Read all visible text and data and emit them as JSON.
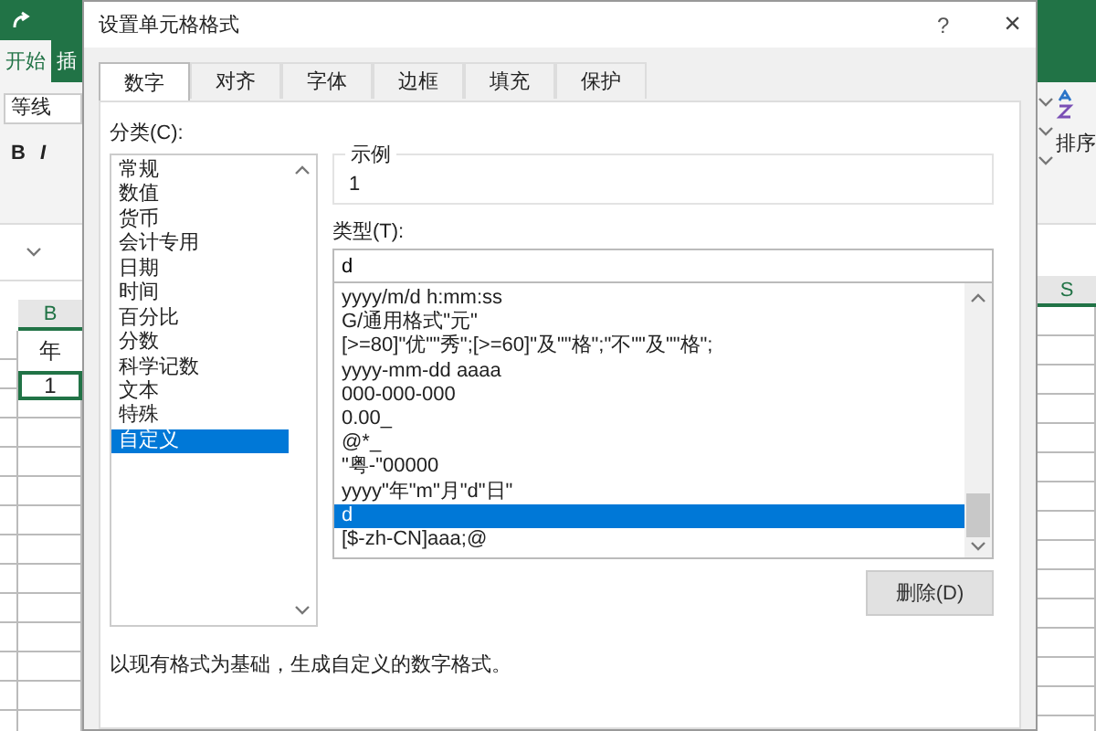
{
  "excel": {
    "ribbon_tabs": [
      {
        "label": "开始",
        "selected": true
      },
      {
        "label": "插",
        "selected": false
      }
    ],
    "font_name": "等线",
    "format_buttons": [
      "B",
      "I"
    ],
    "column_headers": [
      "B",
      "S"
    ],
    "cells": [
      {
        "text": "年",
        "selected": false
      },
      {
        "text": "1",
        "selected": true
      }
    ],
    "sort_label": "排序"
  },
  "dialog": {
    "title": "设置单元格格式",
    "help": "?",
    "close": "×",
    "tabs": [
      {
        "label": "数字",
        "selected": true
      },
      {
        "label": "对齐",
        "selected": false
      },
      {
        "label": "字体",
        "selected": false
      },
      {
        "label": "边框",
        "selected": false
      },
      {
        "label": "填充",
        "selected": false
      },
      {
        "label": "保护",
        "selected": false
      }
    ],
    "category_label": "分类(C):",
    "categories": [
      {
        "label": "常规",
        "selected": false
      },
      {
        "label": "数值",
        "selected": false
      },
      {
        "label": "货币",
        "selected": false
      },
      {
        "label": "会计专用",
        "selected": false
      },
      {
        "label": "日期",
        "selected": false
      },
      {
        "label": "时间",
        "selected": false
      },
      {
        "label": "百分比",
        "selected": false
      },
      {
        "label": "分数",
        "selected": false
      },
      {
        "label": "科学记数",
        "selected": false
      },
      {
        "label": "文本",
        "selected": false
      },
      {
        "label": "特殊",
        "selected": false
      },
      {
        "label": "自定义",
        "selected": true
      }
    ],
    "sample": {
      "legend": "示例",
      "value": "1"
    },
    "type_label": "类型(T):",
    "type_value": "d",
    "formats": [
      {
        "label": "yyyy/m/d h:mm:ss",
        "selected": false
      },
      {
        "label": "G/通用格式\"元\"",
        "selected": false
      },
      {
        "label": "[>=80]\"优\"\"秀\";[>=60]\"及\"\"格\";\"不\"\"及\"\"格\";",
        "selected": false
      },
      {
        "label": "yyyy-mm-dd aaaa",
        "selected": false
      },
      {
        "label": "000-000-000",
        "selected": false
      },
      {
        "label": "0.00_",
        "selected": false
      },
      {
        "label": "@*_",
        "selected": false
      },
      {
        "label": "\"粤-\"00000",
        "selected": false
      },
      {
        "label": "yyyy\"年\"m\"月\"d\"日\"",
        "selected": false
      },
      {
        "label": "d",
        "selected": true
      },
      {
        "label": "[$-zh-CN]aaa;@",
        "selected": false
      }
    ],
    "delete_button": "删除(D)",
    "description": "以现有格式为基础，生成自定义的数字格式。"
  }
}
